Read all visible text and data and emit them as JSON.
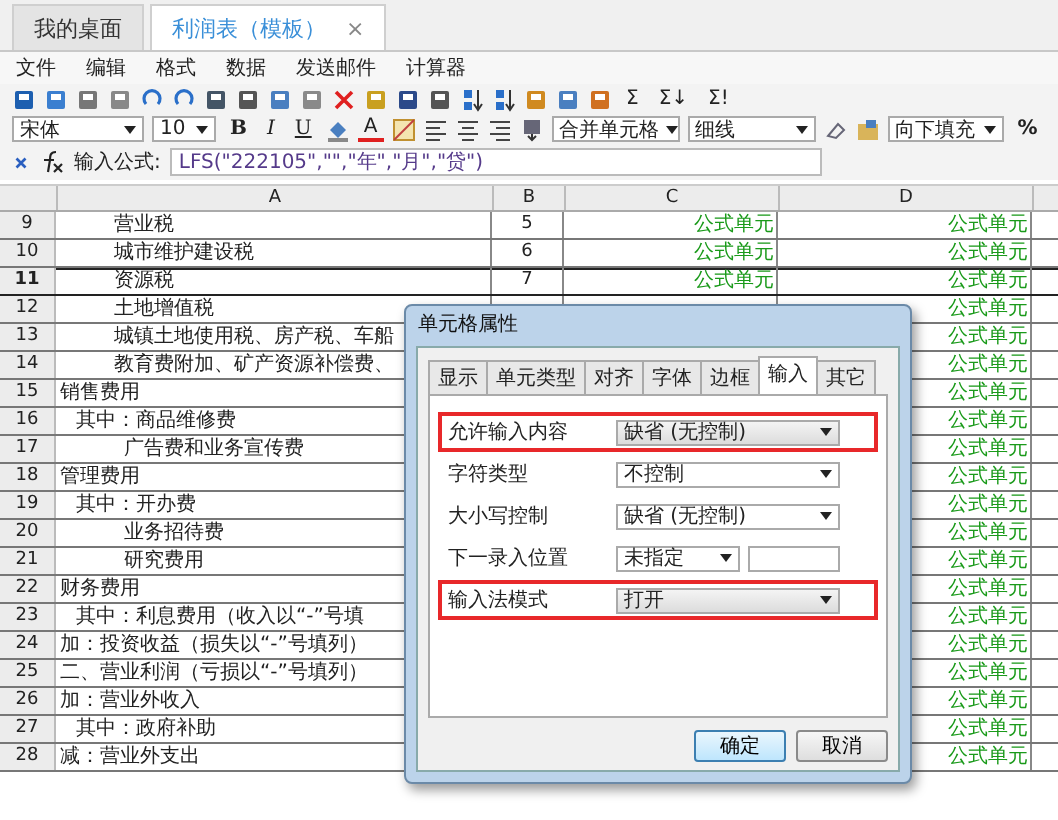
{
  "tabs": [
    {
      "label": "我的桌面",
      "selected": false
    },
    {
      "label": "利润表（模板）",
      "selected": true,
      "close": "×"
    }
  ],
  "menu": [
    "文件",
    "编辑",
    "格式",
    "数据",
    "发送邮件",
    "计算器"
  ],
  "toolbar": {
    "sum_buttons": [
      "Σ",
      "Σ↓",
      "Σ!"
    ],
    "font": "宋体",
    "size": "10",
    "format_buttons": [
      "B",
      "I",
      "U"
    ],
    "font_color": "A",
    "merge": "合并单元格",
    "border": "细线",
    "fill": "向下填充",
    "percent": "%"
  },
  "formula": {
    "label": "输入公式:",
    "value": "LFS(\"222105\",\"\",\"年\",\"月\",\"贷\")"
  },
  "grid": {
    "columns": [
      "A",
      "B",
      "C",
      "D"
    ],
    "rows": [
      {
        "num": "9",
        "a": "营业税",
        "kind": "item",
        "b": "5",
        "c": "公式单元",
        "d": "公式单元",
        "selected": false
      },
      {
        "num": "10",
        "a": "城市维护建设税",
        "kind": "item",
        "b": "6",
        "c": "公式单元",
        "d": "公式单元",
        "selected": false
      },
      {
        "num": "11",
        "a": "资源税",
        "kind": "item",
        "b": "7",
        "c": "公式单元",
        "d": "公式单元",
        "selected": true
      },
      {
        "num": "12",
        "a": "土地增值税",
        "kind": "item",
        "d": "公式单元",
        "selected": false
      },
      {
        "num": "13",
        "a": "城镇土地使用税、房产税、车船",
        "kind": "item",
        "d": "公式单元",
        "selected": false
      },
      {
        "num": "14",
        "a": "教育费附加、矿产资源补偿费、",
        "kind": "item",
        "d": "公式单元",
        "selected": false
      },
      {
        "num": "15",
        "a": "销售费用",
        "kind": "top",
        "d": "公式单元",
        "selected": false
      },
      {
        "num": "16",
        "a": "其中：商品维修费",
        "kind": "sub",
        "d": "公式单元",
        "selected": false
      },
      {
        "num": "17",
        "a": "广告费和业务宣传费",
        "kind": "subitem",
        "d": "公式单元",
        "selected": false
      },
      {
        "num": "18",
        "a": "管理费用",
        "kind": "top",
        "d": "公式单元",
        "selected": false
      },
      {
        "num": "19",
        "a": "其中：开办费",
        "kind": "sub",
        "d": "公式单元",
        "selected": false
      },
      {
        "num": "20",
        "a": "业务招待费",
        "kind": "subitem",
        "d": "公式单元",
        "selected": false
      },
      {
        "num": "21",
        "a": "研究费用",
        "kind": "subitem",
        "d": "公式单元",
        "selected": false
      },
      {
        "num": "22",
        "a": "财务费用",
        "kind": "top",
        "d": "公式单元",
        "selected": false
      },
      {
        "num": "23",
        "a": "其中：利息费用（收入以“-”号填",
        "kind": "sub",
        "d": "公式单元",
        "selected": false
      },
      {
        "num": "24",
        "a": "加：投资收益（损失以“-”号填列）",
        "kind": "top",
        "d": "公式单元",
        "selected": false
      },
      {
        "num": "25",
        "a": "二、营业利润（亏损以“-”号填列）",
        "kind": "top",
        "d": "公式单元",
        "selected": false
      },
      {
        "num": "26",
        "a": "加：营业外收入",
        "kind": "top",
        "d": "公式单元",
        "selected": false
      },
      {
        "num": "27",
        "a": "其中：政府补助",
        "kind": "sub",
        "d": "公式单元",
        "selected": false
      },
      {
        "num": "28",
        "a": "减：营业外支出",
        "kind": "top",
        "d": "公式单元",
        "selected": false
      }
    ]
  },
  "dialog": {
    "title": "单元格属性",
    "tabs": [
      {
        "label": "显示",
        "selected": false
      },
      {
        "label": "单元类型",
        "selected": false
      },
      {
        "label": "对齐",
        "selected": false
      },
      {
        "label": "字体",
        "selected": false
      },
      {
        "label": "边框",
        "selected": false
      },
      {
        "label": "输入",
        "selected": true
      },
      {
        "label": "其它",
        "selected": false
      }
    ],
    "fields": [
      {
        "label": "允许输入内容",
        "value": "缺省 (无控制)",
        "kind": "select",
        "highlighted": true
      },
      {
        "label": "字符类型",
        "value": "不控制",
        "kind": "select",
        "highlighted": false
      },
      {
        "label": "大小写控制",
        "value": "缺省 (无控制)",
        "kind": "select",
        "highlighted": false
      },
      {
        "label": "下一录入位置",
        "value": "未指定",
        "kind": "select-input",
        "highlighted": false
      },
      {
        "label": "输入法模式",
        "value": "打开",
        "kind": "select",
        "highlighted": true
      }
    ],
    "buttons": [
      {
        "label": "确定",
        "default": true
      },
      {
        "label": "取消",
        "default": false
      }
    ]
  }
}
